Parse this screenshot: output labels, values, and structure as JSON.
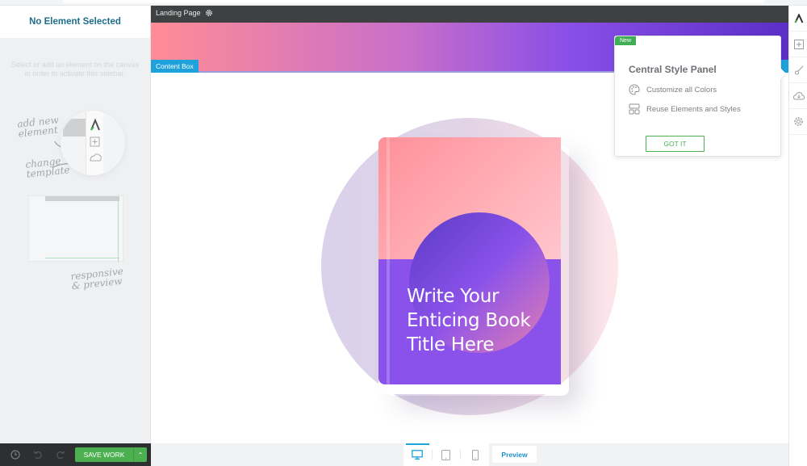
{
  "sidebar": {
    "title": "No Element Selected",
    "hint": "Select or add an element on the canvas in order to activate this sidebar.",
    "illustration": {
      "label_add": "add new element",
      "label_add_l1": "add new",
      "label_add_l2": "element",
      "label_change_l1": "change",
      "label_change_l2": "template",
      "label_responsive_l1": "responsive",
      "label_responsive_l2": "& preview"
    },
    "collapse_icon": "caret-left-icon"
  },
  "bottom_toolbar": {
    "history_icon": "history-clock-icon",
    "undo_icon": "undo-icon",
    "redo_icon": "redo-icon",
    "save_label": "SAVE WORK",
    "save_menu_icon": "chevron-up-icon"
  },
  "canvas": {
    "page_label": "Landing Page",
    "page_settings_icon": "gear-icon",
    "content_box_tag": "Content Box",
    "book": {
      "title_line1": "Write Your",
      "title_line2": "Enticing Book",
      "title_line3": "Title Here"
    }
  },
  "popup": {
    "badge": "New",
    "title": "Central Style Panel",
    "items": [
      {
        "icon": "palette-icon",
        "label": "Customize all Colors"
      },
      {
        "icon": "layout-blocks-icon",
        "label": "Reuse Elements and Styles"
      }
    ],
    "button_label": "GOT IT"
  },
  "right_rail": {
    "items": [
      {
        "icon": "brand-logo-icon"
      },
      {
        "icon": "add-element-icon"
      },
      {
        "icon": "brush-icon"
      },
      {
        "icon": "cloud-download-icon"
      },
      {
        "icon": "settings-gear-icon"
      }
    ]
  },
  "device_bar": {
    "devices": [
      {
        "name": "desktop",
        "active": true
      },
      {
        "name": "tablet",
        "active": false
      },
      {
        "name": "mobile",
        "active": false
      }
    ],
    "preview_label": "Preview"
  },
  "colors": {
    "accent_blue": "#1fa2dc",
    "save_green": "#4caf50",
    "title_teal": "#1f6e8c",
    "book_purple": "#8a52eb",
    "book_pink": "#ff9099"
  }
}
